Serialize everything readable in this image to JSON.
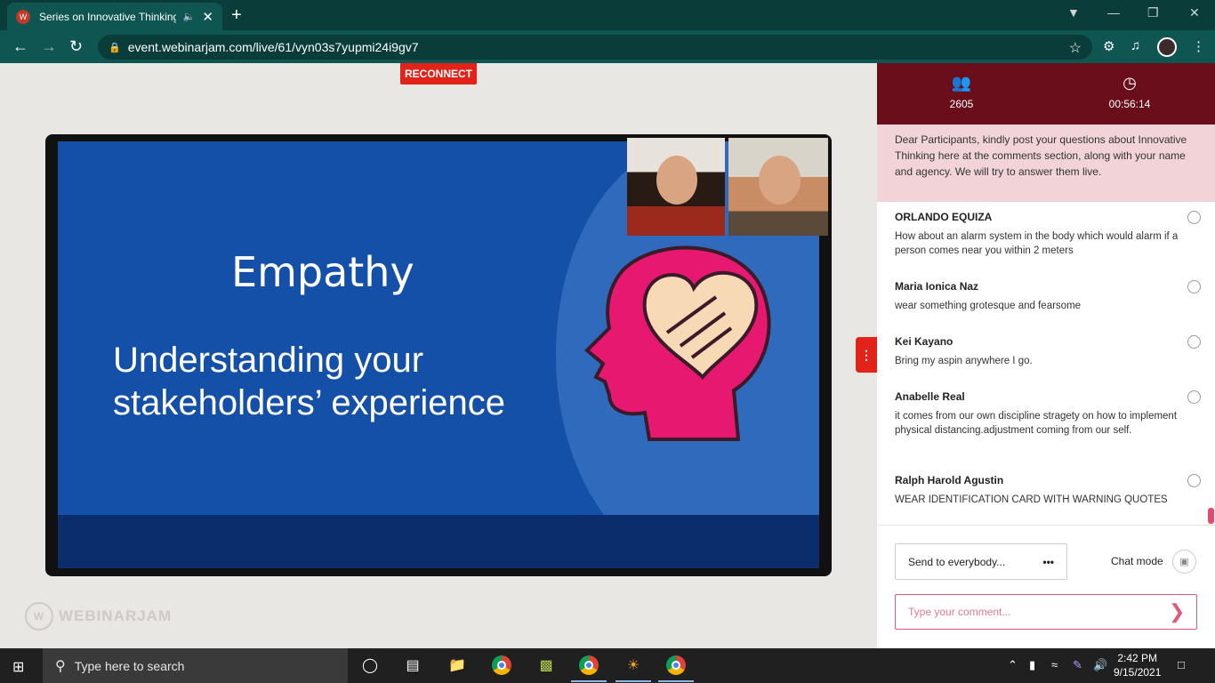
{
  "browser": {
    "tab_title": "Series on Innovative Thinking",
    "url": "event.webinarjam.com/live/61/vyn03s7yupmi24i9gv7"
  },
  "stage": {
    "reconnect_label": "RECONNECT",
    "slide_title": "Empathy",
    "slide_subtitle": "Understanding your stakeholders’ experience",
    "brand": "WEBINARJAM"
  },
  "sidebar": {
    "attendee_count": "2605",
    "elapsed_time": "00:56:14",
    "notice": "Dear Participants, kindly post your questions about Innovative Thinking here at the comments section, along with your name and agency. We will try to answer them live.",
    "comments": [
      {
        "name": "ORLANDO EQUIZA",
        "text": "How about an alarm system in the body which would alarm if a person comes near you within 2 meters"
      },
      {
        "name": "Maria Ionica Naz",
        "text": "wear something grotesque and fearsome"
      },
      {
        "name": "Kei Kayano",
        "text": "Bring my aspin anywhere I go."
      },
      {
        "name": "Anabelle Real",
        "text": "it comes from our own discipline stragety on how to implement physical distancing.adjustment coming from our self."
      },
      {
        "name": "Ralph Harold Agustin",
        "text": "WEAR IDENTIFICATION CARD WITH WARNING QUOTES"
      }
    ],
    "send_to_label": "Send to everybody...",
    "send_to_more": "•••",
    "chat_mode_label": "Chat mode",
    "comment_placeholder": "Type your comment..."
  },
  "taskbar": {
    "search_placeholder": "Type here to search",
    "time": "2:42 PM",
    "date": "9/15/2021"
  },
  "colors": {
    "accent": "#e2231a",
    "sidebar_header": "#6b0e1c",
    "notice_bg": "#f1d3d8",
    "browser_bar": "#0f5652"
  }
}
